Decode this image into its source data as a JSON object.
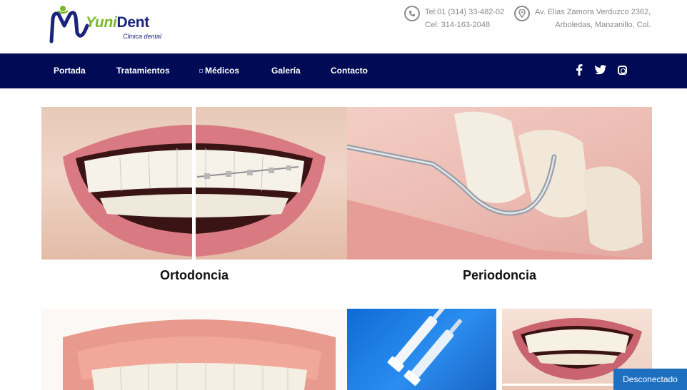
{
  "brand": {
    "name_part1": "Yuni",
    "name_part2": "Dent",
    "tagline": "Clinica dental",
    "colors": {
      "primary": "#000a55",
      "accent": "#79b829",
      "status": "#1e6fc0"
    }
  },
  "contact": {
    "phone_icon": "phone-icon",
    "phone_line1": "Tel:01 (314) 33-482-02",
    "phone_line2": "Cel: 314-163-2048",
    "address_icon": "map-pin-icon",
    "address_line1": "Av. Elias Zamora Verduzco 2362,",
    "address_line2": "Arboledas, Manzanillo, Col."
  },
  "nav": {
    "items": [
      {
        "label": "Portada"
      },
      {
        "label": "Tratamientos"
      },
      {
        "label": "Médicos"
      },
      {
        "label": "Galería"
      },
      {
        "label": "Contacto"
      }
    ],
    "social": [
      {
        "name": "facebook-icon",
        "glyph": "f"
      },
      {
        "name": "twitter-icon",
        "glyph": "🐦"
      },
      {
        "name": "instagram-icon",
        "glyph": ""
      }
    ]
  },
  "treatments": [
    {
      "caption": "Ortodoncia"
    },
    {
      "caption": "Periodoncia"
    }
  ],
  "status": {
    "label": "Desconectado"
  }
}
